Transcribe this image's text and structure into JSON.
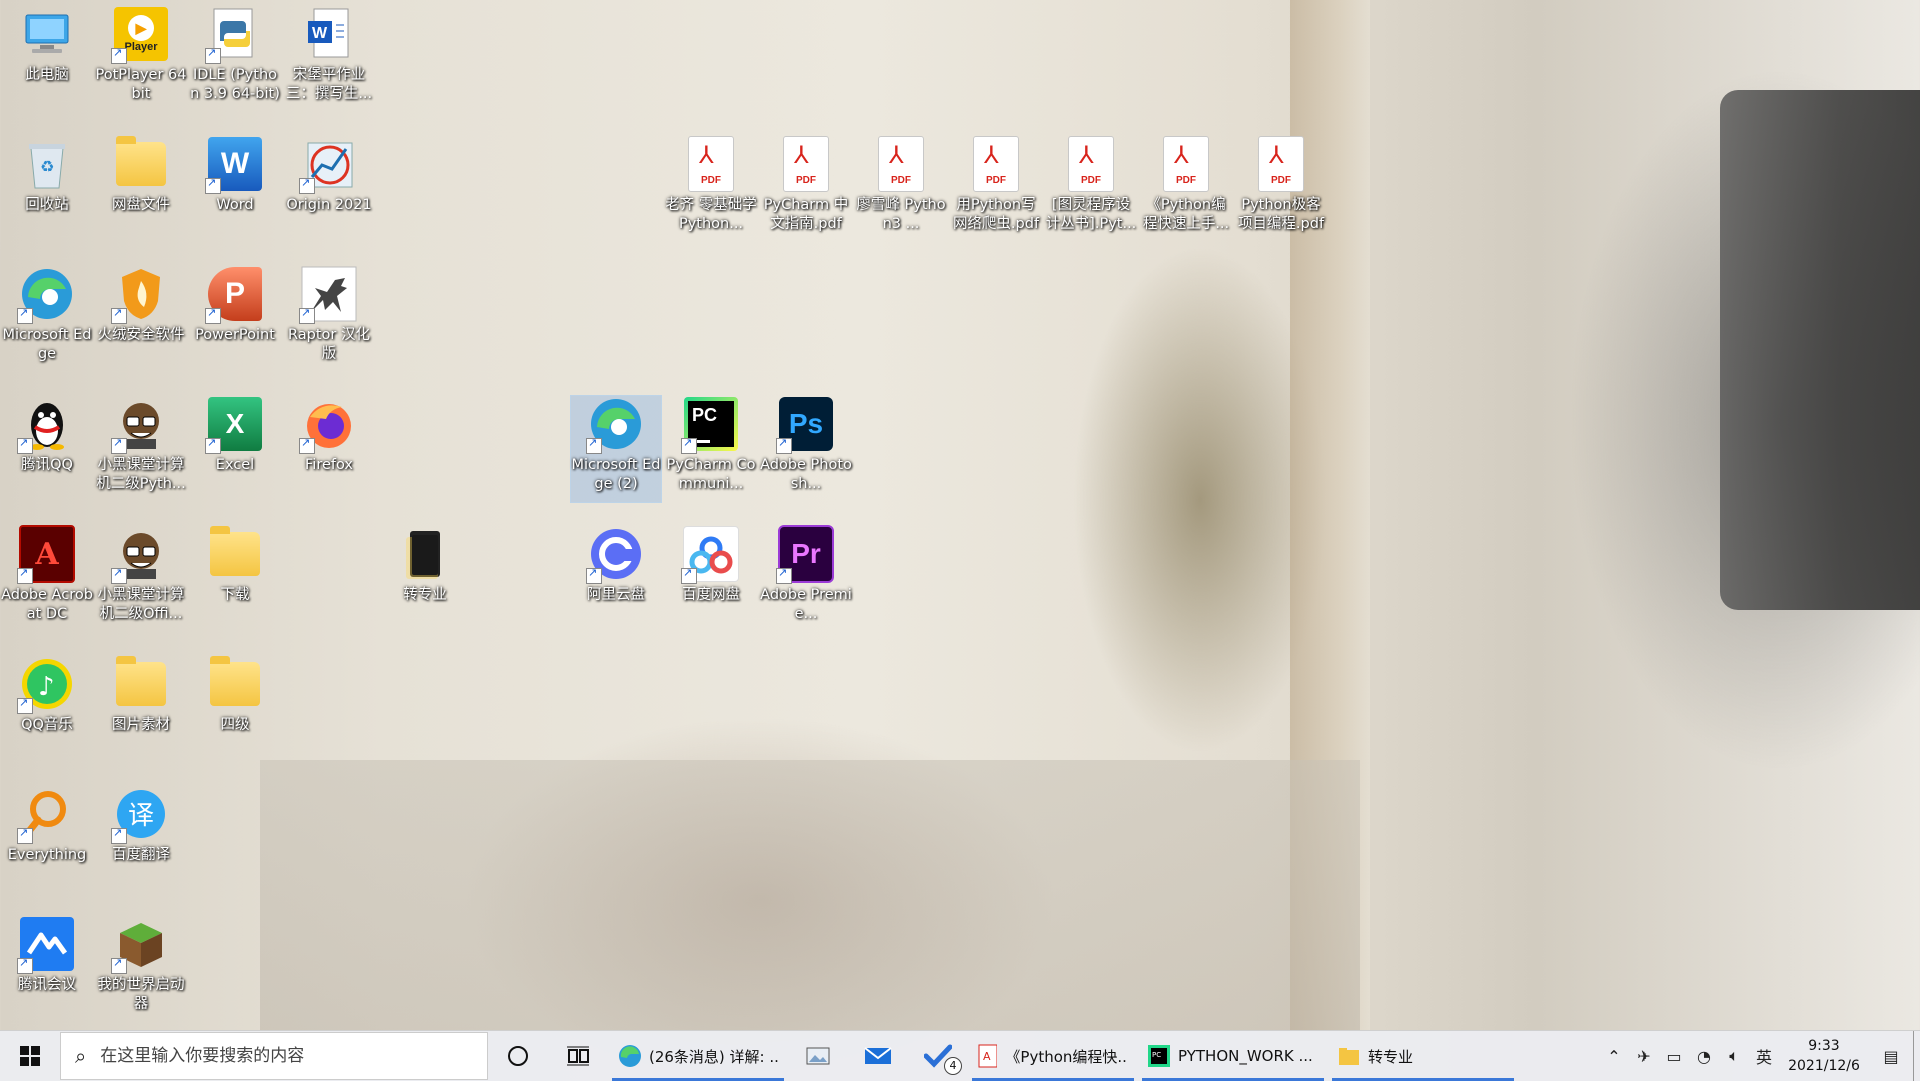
{
  "desktop": {
    "icons": [
      {
        "label": "此电脑",
        "icon": "computer-icon"
      },
      {
        "label": "PotPlayer 64 bit",
        "icon": "potplayer-icon"
      },
      {
        "label": "IDLE (Python 3.9 64-bit)",
        "icon": "python-idle-icon"
      },
      {
        "label": "宋堡平作业三：撰写生...",
        "icon": "word-document-icon"
      },
      {
        "label": "回收站",
        "icon": "recycle-bin-icon"
      },
      {
        "label": "网盘文件",
        "icon": "folder-icon"
      },
      {
        "label": "Word",
        "icon": "word-icon"
      },
      {
        "label": "Origin 2021",
        "icon": "origin-icon"
      },
      {
        "label": "Microsoft Edge",
        "icon": "edge-icon"
      },
      {
        "label": "火绒安全软件",
        "icon": "huorong-icon"
      },
      {
        "label": "PowerPoint",
        "icon": "powerpoint-icon"
      },
      {
        "label": "Raptor 汉化版",
        "icon": "raptor-icon"
      },
      {
        "label": "腾讯QQ",
        "icon": "qq-icon"
      },
      {
        "label": "小黑课堂计算机二级Pyth...",
        "icon": "xiaohei-icon"
      },
      {
        "label": "Excel",
        "icon": "excel-icon"
      },
      {
        "label": "Firefox",
        "icon": "firefox-icon"
      },
      {
        "label": "Adobe Acrobat DC",
        "icon": "acrobat-icon"
      },
      {
        "label": "小黑课堂计算机二级Offi...",
        "icon": "xiaohei-icon"
      },
      {
        "label": "下载",
        "icon": "folder-icon"
      },
      {
        "label": "转专业",
        "icon": "folder-dark-icon"
      },
      {
        "label": "QQ音乐",
        "icon": "qq-music-icon"
      },
      {
        "label": "图片素材",
        "icon": "folder-icon"
      },
      {
        "label": "四级",
        "icon": "folder-icon"
      },
      {
        "label": "Everything",
        "icon": "everything-icon"
      },
      {
        "label": "百度翻译",
        "icon": "baidu-translate-icon"
      },
      {
        "label": "腾讯会议",
        "icon": "tencent-meeting-icon"
      },
      {
        "label": "我的世界启动器",
        "icon": "minecraft-icon"
      },
      {
        "label": "Microsoft Edge (2)",
        "icon": "edge-icon"
      },
      {
        "label": "PyCharm Communi...",
        "icon": "pycharm-icon"
      },
      {
        "label": "Adobe Photosh...",
        "icon": "photoshop-icon"
      },
      {
        "label": "阿里云盘",
        "icon": "aliyun-drive-icon"
      },
      {
        "label": "百度网盘",
        "icon": "baidu-netdisk-icon"
      },
      {
        "label": "Adobe Premie...",
        "icon": "premiere-icon"
      }
    ],
    "pdfs": [
      {
        "label": "老齐 零基础学Python...",
        "icon": "pdf-icon"
      },
      {
        "label": "PyCharm 中文指南.pdf",
        "icon": "pdf-icon"
      },
      {
        "label": "廖雪峰 Python3 ...",
        "icon": "pdf-icon"
      },
      {
        "label": "用Python写网络爬虫.pdf",
        "icon": "pdf-icon"
      },
      {
        "label": "[图灵程序设计丛书].Pyt...",
        "icon": "pdf-icon"
      },
      {
        "label": "《Python编程快速上手...",
        "icon": "pdf-icon"
      },
      {
        "label": "Python极客项目编程.pdf",
        "icon": "pdf-icon"
      }
    ],
    "pdf_tag": "PDF"
  },
  "taskbar": {
    "search_placeholder": "在这里输入你要搜索的内容",
    "apps": [
      {
        "label": "(26条消息) 详解: ...",
        "icon": "edge-icon"
      },
      {
        "label": "《Python编程快...",
        "icon": "pdf-icon"
      },
      {
        "label": "PYTHON_WORK ...",
        "icon": "pycharm-icon"
      },
      {
        "label": "转专业",
        "icon": "folder-icon"
      }
    ],
    "todo_badge": "4",
    "ime": "英",
    "time": "9:33",
    "date": "2021/12/6"
  },
  "colors": {
    "accent": "#3b78d8",
    "taskbar_bg": "#ebecf0"
  }
}
